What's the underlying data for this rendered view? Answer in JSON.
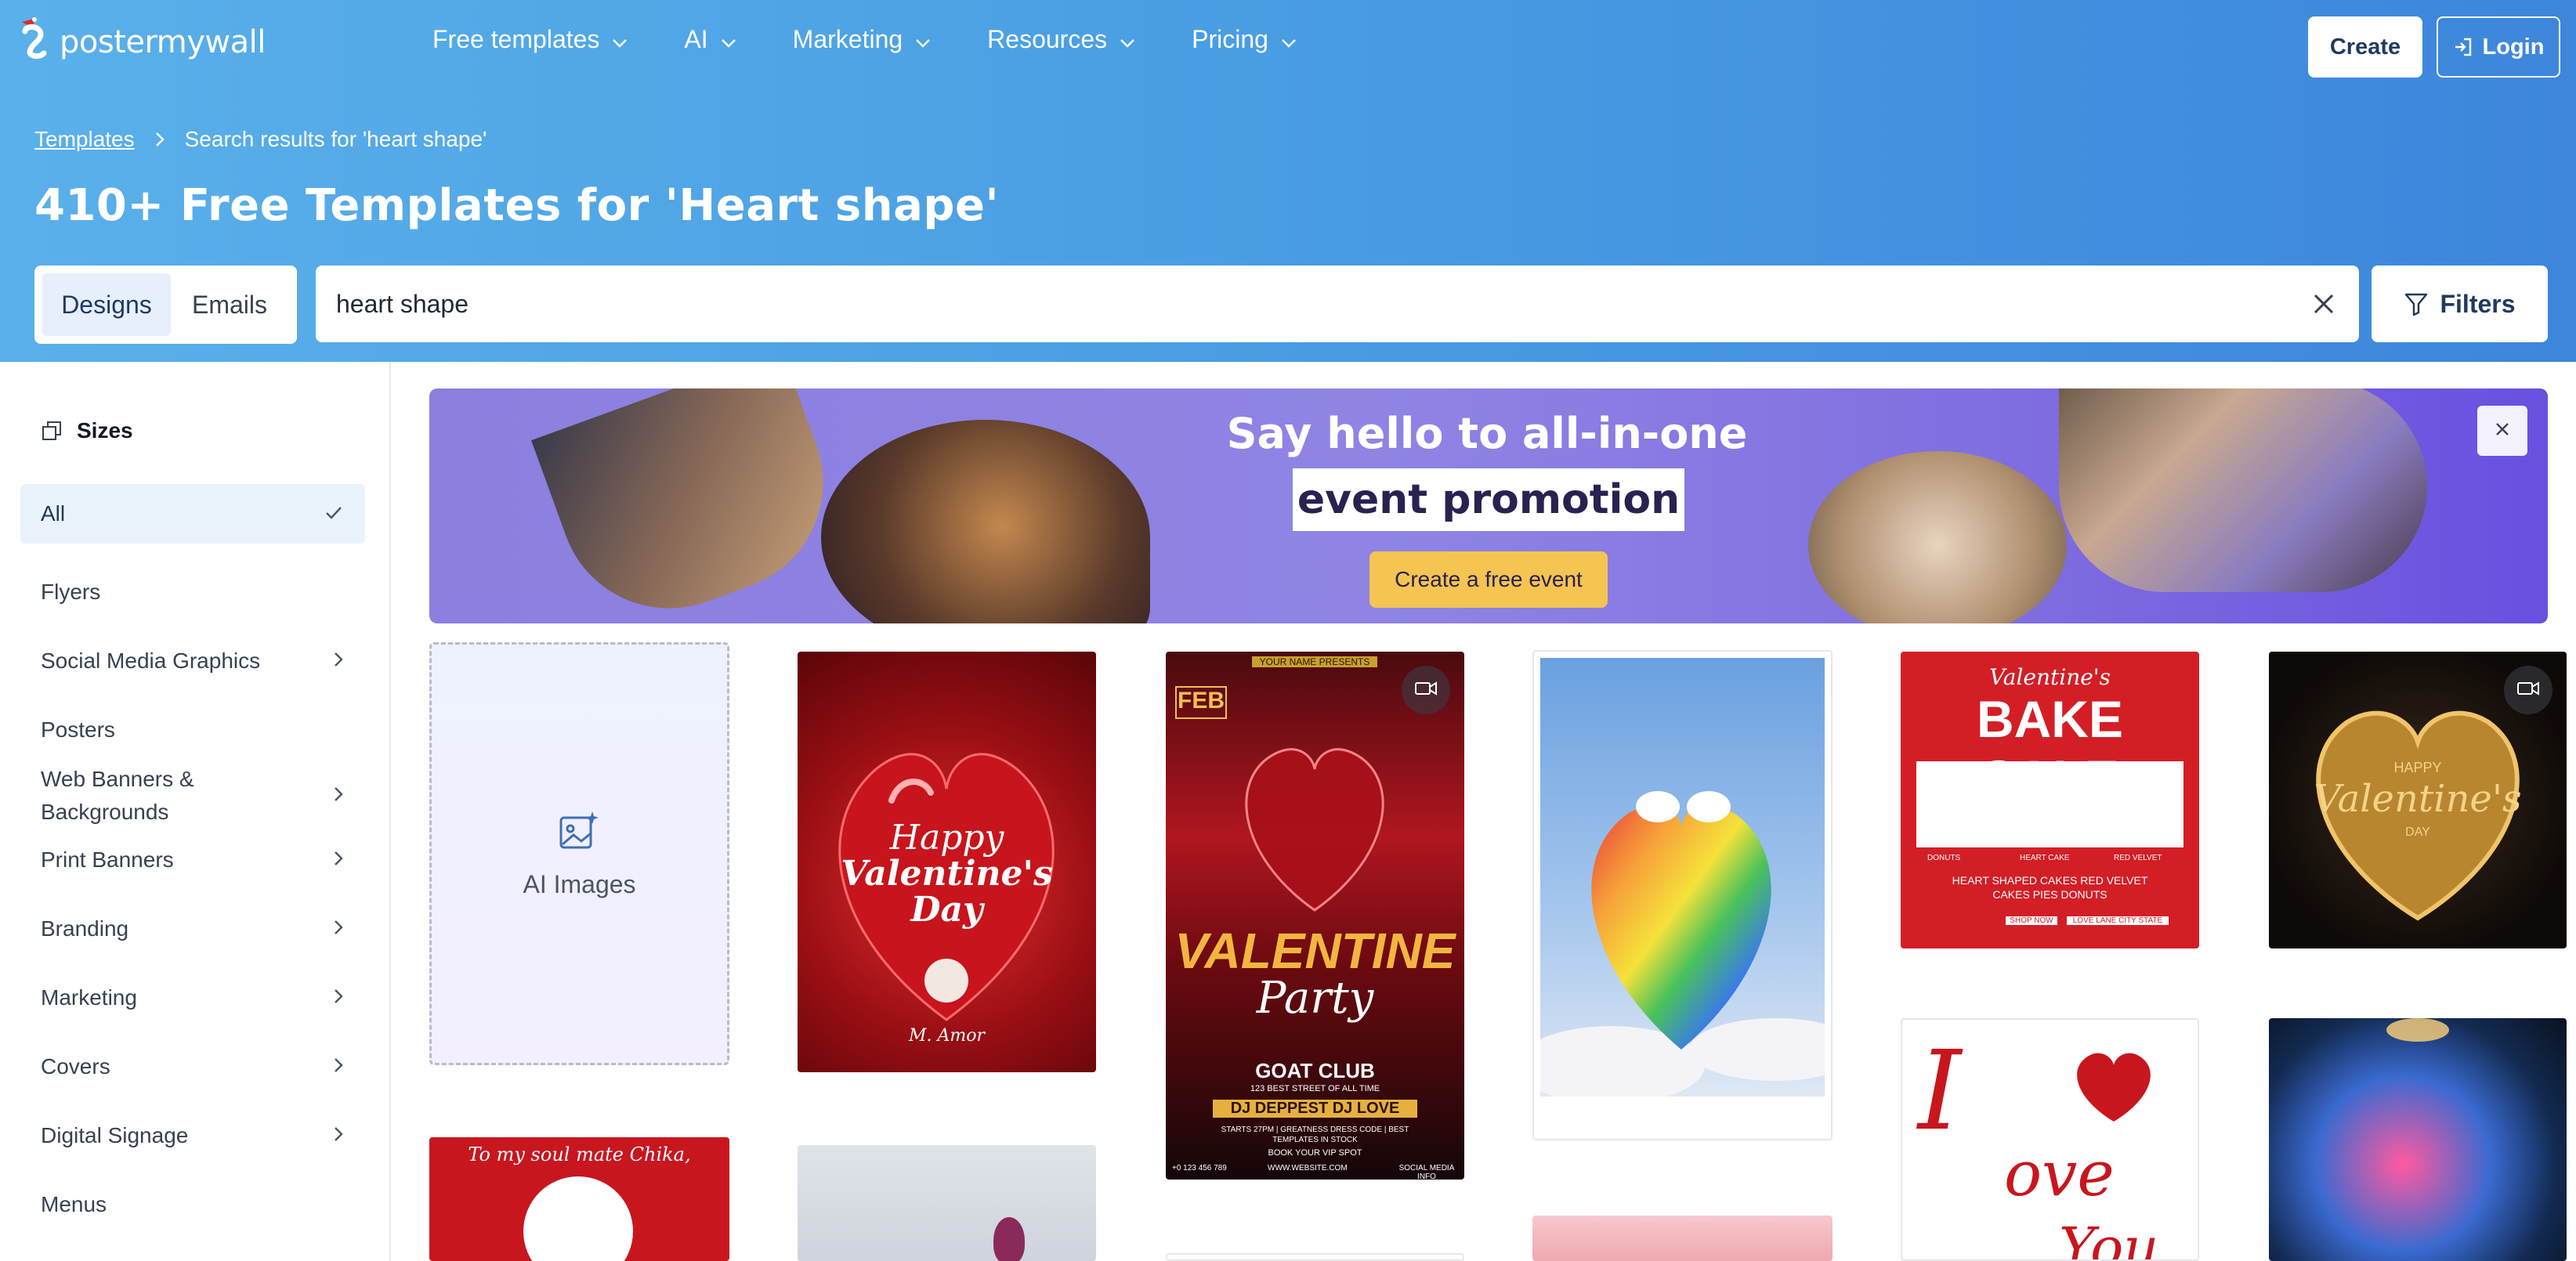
{
  "brand": {
    "name": "postermywall"
  },
  "nav": {
    "items": [
      {
        "label": "Free templates"
      },
      {
        "label": "AI"
      },
      {
        "label": "Marketing"
      },
      {
        "label": "Resources"
      },
      {
        "label": "Pricing"
      }
    ],
    "create_label": "Create",
    "login_label": "Login"
  },
  "breadcrumb": {
    "root": "Templates",
    "current": "Search results for 'heart shape'"
  },
  "page_title": "410+ Free Templates for 'Heart shape'",
  "search": {
    "tabs": [
      {
        "label": "Designs",
        "active": true
      },
      {
        "label": "Emails",
        "active": false
      }
    ],
    "value": "heart shape",
    "filters_label": "Filters"
  },
  "sidebar": {
    "heading": "Sizes",
    "items": [
      {
        "label": "All",
        "active": true,
        "has_children": false
      },
      {
        "label": "Flyers",
        "has_children": false
      },
      {
        "label": "Social Media Graphics",
        "has_children": true
      },
      {
        "label": "Posters",
        "has_children": false
      },
      {
        "label": "Web Banners & Backgrounds",
        "has_children": true
      },
      {
        "label": "Print Banners",
        "has_children": true
      },
      {
        "label": "Branding",
        "has_children": true
      },
      {
        "label": "Marketing",
        "has_children": true
      },
      {
        "label": "Covers",
        "has_children": true
      },
      {
        "label": "Digital Signage",
        "has_children": true
      },
      {
        "label": "Menus",
        "has_children": false
      }
    ]
  },
  "promo": {
    "line1": "Say hello to all-in-one",
    "line2": "event promotion",
    "cta": "Create a free event"
  },
  "grid": {
    "ai_tile_label": "AI Images",
    "templates": [
      {
        "name": "Happy Valentine's Day red heart",
        "text": [
          "Happy",
          "Valentine's",
          "Day",
          "M. Amor"
        ],
        "video": false
      },
      {
        "name": "Valentine Party flyer",
        "text": [
          "YOUR NAME PRESENTS",
          "FEB",
          "VALENTINE",
          "Party",
          "GOAT CLUB",
          "123 BEST STREET OF ALL TIME",
          "DJ DEPPEST  DJ LOVE",
          "STARTS 27PM | GREATNESS DRESS CODE | BEST TEMPLATES IN STOCK",
          "BOOK YOUR VIP SPOT",
          "+0 123 456 789",
          "WWW.WEBSITE.COM",
          "SOCIAL MEDIA INFO"
        ],
        "video": true
      },
      {
        "name": "Rainbow heart birds",
        "text": [],
        "video": false
      },
      {
        "name": "Valentine's Bake Sale",
        "text": [
          "Valentine's",
          "BAKE SALE",
          "DONUTS",
          "HEART CAKE",
          "RED VELVET",
          "HEART SHAPED CAKES RED VELVET",
          "CAKES PIES DONUTS",
          "SHOP NOW",
          "LOVE LANE CITY STATE"
        ],
        "video": false
      },
      {
        "name": "Golden heart Happy Valentine's Day",
        "text": [
          "HAPPY",
          "Valentine's",
          "DAY"
        ],
        "video": true
      },
      {
        "name": "To my soul mate",
        "text": [
          "To my soul mate Chika,"
        ],
        "video": false
      },
      {
        "name": "I Love You lettering",
        "text": [
          "I",
          "ove",
          "You"
        ],
        "video": false
      }
    ]
  },
  "colors": {
    "header_gradient_start": "#5ab0ea",
    "header_gradient_end": "#3d86dc",
    "promo_purple": "#8b7fe0",
    "cta_yellow": "#f5c451",
    "active_bg": "#eaf2fb"
  }
}
